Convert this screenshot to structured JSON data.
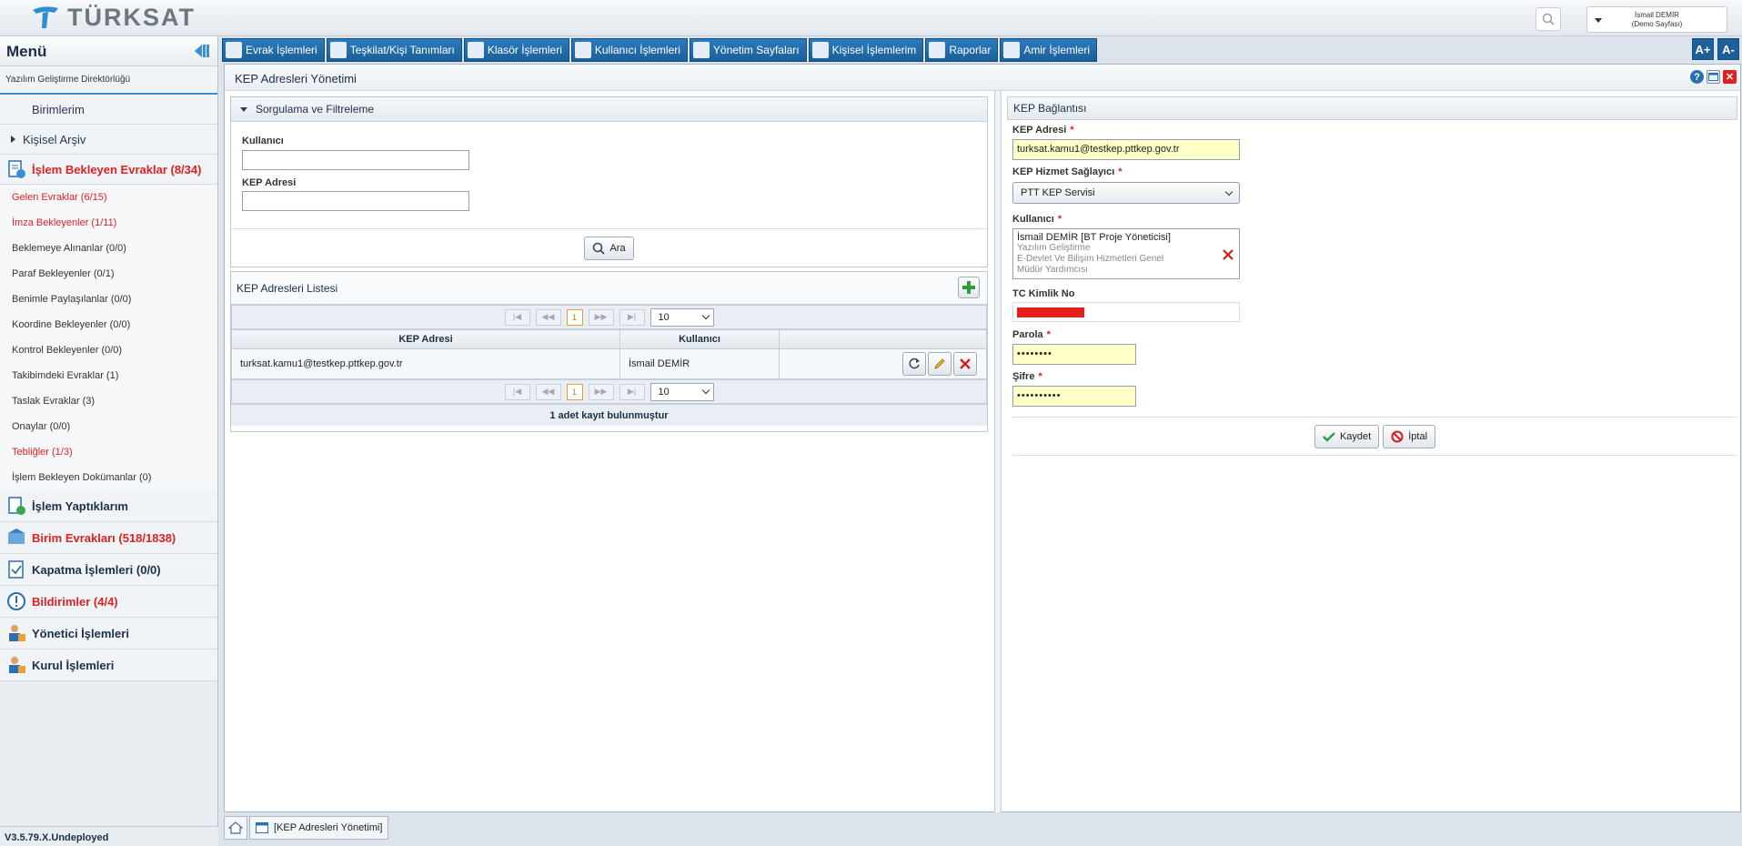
{
  "header": {
    "logo_text": "TÜRKSAT",
    "user_name": "İsmail DEMİR",
    "user_page": "(Demo Sayfası)"
  },
  "sidebar": {
    "title": "Menü",
    "org": "Yazılım Geliştirme Direktörlüğü",
    "birimlerim": "Birimlerim",
    "kisisel_arsiv": "Kişisel Arşiv",
    "islem_bekleyen": "İşlem Bekleyen Evraklar (8/34)",
    "sub_items": [
      {
        "label": "Gelen Evraklar (6/15)",
        "red": true
      },
      {
        "label": "İmza Bekleyenler (1/11)",
        "red": true
      },
      {
        "label": "Beklemeye Alınanlar (0/0)",
        "red": false
      },
      {
        "label": "Paraf Bekleyenler (0/1)",
        "red": false
      },
      {
        "label": "Benimle Paylaşılanlar (0/0)",
        "red": false
      },
      {
        "label": "Koordine Bekleyenler (0/0)",
        "red": false
      },
      {
        "label": "Kontrol Bekleyenler (0/0)",
        "red": false
      },
      {
        "label": "Takibimdeki Evraklar (1)",
        "red": false
      },
      {
        "label": "Taslak Evraklar (3)",
        "red": false
      },
      {
        "label": "Onaylar (0/0)",
        "red": false
      },
      {
        "label": "Tebliğler (1/3)",
        "red": true
      },
      {
        "label": "İşlem Bekleyen Dokümanlar (0)",
        "red": false
      }
    ],
    "islem_yaptiklarim": "İşlem Yaptıklarım",
    "birim_evraklari": "Birim Evrakları (518/1838)",
    "kapatma": "Kapatma İşlemleri (0/0)",
    "bildirimler": "Bildirimler (4/4)",
    "yonetici": "Yönetici İşlemleri",
    "kurul": "Kurul İşlemleri",
    "version": "V3.5.79.X.Undeployed"
  },
  "nav": {
    "items": [
      "Evrak İşlemleri",
      "Teşkilat/Kişi Tanımları",
      "Klasör İşlemleri",
      "Kullanıcı İşlemleri",
      "Yönetim Sayfaları",
      "Kişisel İşlemlerim",
      "Raporlar",
      "Amir İşlemleri"
    ],
    "font_up": "A+",
    "font_down": "A-"
  },
  "panel": {
    "title": "KEP Adresleri Yönetimi"
  },
  "filter": {
    "title": "Sorgulama ve Filtreleme",
    "kullanici_label": "Kullanıcı",
    "kullanici_value": "",
    "kep_label": "KEP Adresi",
    "kep_value": "",
    "search_button": "Ara"
  },
  "list": {
    "title": "KEP Adresleri Listesi",
    "columns": [
      "KEP Adresi",
      "Kullanıcı"
    ],
    "rows": [
      {
        "kep": "turksat.kamu1@testkep.pttkep.gov.tr",
        "user": "İsmail DEMİR"
      }
    ],
    "current_page": "1",
    "page_size": "10",
    "record_count": "1 adet kayıt bulunmuştur"
  },
  "form": {
    "title": "KEP Bağlantısı",
    "kep_label": "KEP Adresi",
    "kep_value": "turksat.kamu1@testkep.pttkep.gov.tr",
    "provider_label": "KEP Hizmet Sağlayıcı",
    "provider_value": "PTT KEP Servisi",
    "user_label": "Kullanıcı",
    "user_name": "İsmail DEMİR [BT Proje Yöneticisi]",
    "user_line2": "Yazılım Geliştirme",
    "user_line3": "E-Devlet Ve Bilişim Hizmetleri Genel",
    "user_line4": "Müdür Yardımcısı",
    "tc_label": "TC Kimlik No",
    "parola_label": "Parola",
    "parola_value": "••••••••",
    "sifre_label": "Şifre",
    "sifre_value": "••••••••••",
    "save_button": "Kaydet",
    "cancel_button": "İptal"
  },
  "bottom_tab": "[KEP Adresleri Yönetimi]",
  "colors": {
    "accent": "#1c5f99",
    "alert": "#e02121",
    "input_highlight": "#ffffc8"
  }
}
